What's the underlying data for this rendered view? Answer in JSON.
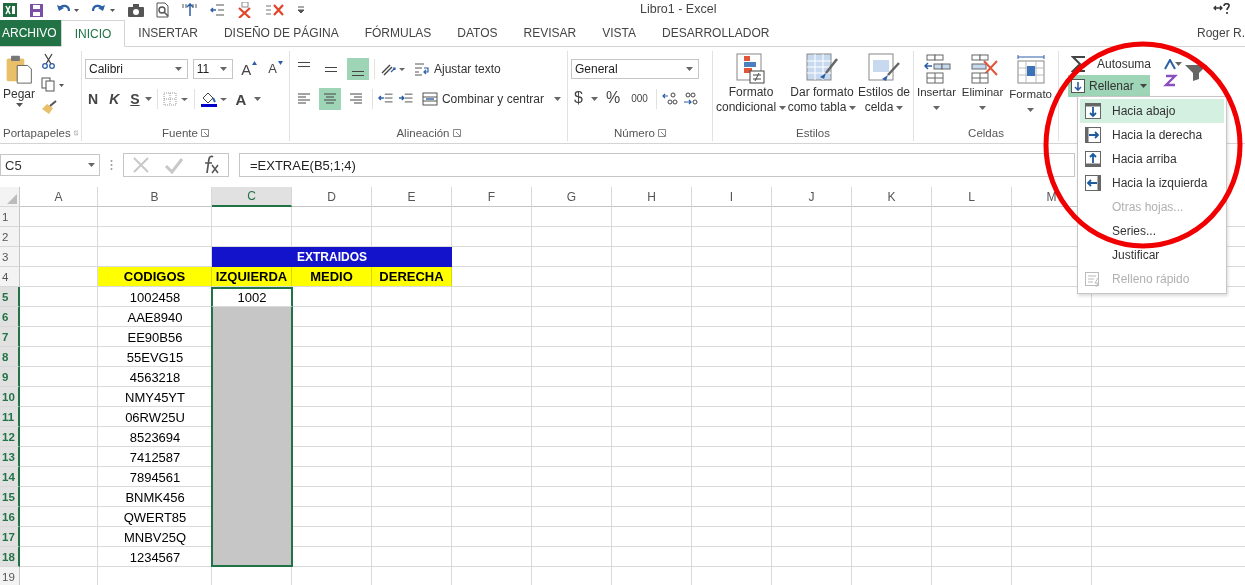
{
  "window": {
    "title": "Libro1 - Excel",
    "user": "Roger R."
  },
  "tabs": [
    {
      "label": "ARCHIVO",
      "kind": "file",
      "selected": false
    },
    {
      "label": "INICIO",
      "kind": "tab",
      "selected": true
    },
    {
      "label": "INSERTAR",
      "kind": "tab",
      "selected": false
    },
    {
      "label": "DISEÑO DE PÁGINA",
      "kind": "tab",
      "selected": false
    },
    {
      "label": "FÓRMULAS",
      "kind": "tab",
      "selected": false
    },
    {
      "label": "DATOS",
      "kind": "tab",
      "selected": false
    },
    {
      "label": "REVISAR",
      "kind": "tab",
      "selected": false
    },
    {
      "label": "VISTA",
      "kind": "tab",
      "selected": false
    },
    {
      "label": "DESARROLLADOR",
      "kind": "tab",
      "selected": false
    }
  ],
  "ribbon": {
    "clipboard": {
      "paste": "Pegar",
      "label": "Portapapeles"
    },
    "font": {
      "name": "Calibri",
      "size": "11",
      "grow": "A",
      "shrink": "A",
      "bold": "N",
      "italic": "K",
      "underline": "S",
      "font_color_label": "A",
      "label": "Fuente"
    },
    "alignment": {
      "vertical": [
        {
          "selected": false
        },
        {
          "selected": false
        },
        {
          "selected": true
        }
      ],
      "horizontal": [
        {
          "selected": false
        },
        {
          "selected": true
        },
        {
          "selected": false
        }
      ],
      "wrap": "Ajustar texto",
      "merge": "Combinar y centrar",
      "label": "Alineación"
    },
    "number": {
      "format": "General",
      "currency": "$",
      "percent": "%",
      "thousands": "000",
      "label": "Número"
    },
    "styles": {
      "buttons": [
        {
          "lines": [
            "Formato",
            "condicional"
          ]
        },
        {
          "lines": [
            "Dar formato",
            "como tabla"
          ]
        },
        {
          "lines": [
            "Estilos de",
            "celda"
          ]
        }
      ],
      "label": "Estilos"
    },
    "cells": {
      "buttons": [
        "Insertar",
        "Eliminar",
        "Formato"
      ],
      "label": "Celdas"
    },
    "editing": {
      "autosum": "Autosuma",
      "fill": {
        "label": "Rellenar",
        "selected": true
      }
    }
  },
  "fill_menu": [
    {
      "label": "Hacia abajo",
      "kind": "down",
      "selected": true,
      "disabled": false
    },
    {
      "label": "Hacia la derecha",
      "kind": "right",
      "selected": false,
      "disabled": false
    },
    {
      "label": "Hacia arriba",
      "kind": "up",
      "selected": false,
      "disabled": false
    },
    {
      "label": "Hacia la izquierda",
      "kind": "left",
      "selected": false,
      "disabled": false
    },
    {
      "label": "Otras hojas...",
      "kind": "plain",
      "selected": false,
      "disabled": true
    },
    {
      "label": "Series...",
      "kind": "plain",
      "selected": false,
      "disabled": false
    },
    {
      "label": "Justificar",
      "kind": "plain",
      "selected": false,
      "disabled": false
    },
    {
      "label": "Relleno rápido",
      "kind": "flash",
      "selected": false,
      "disabled": true
    }
  ],
  "formula_bar": {
    "name_box": "C5",
    "formula": "=EXTRAE(B5;1;4)"
  },
  "sheet": {
    "columns": [
      {
        "label": "A",
        "selected": false
      },
      {
        "label": "B",
        "selected": false
      },
      {
        "label": "C",
        "selected": true
      },
      {
        "label": "D",
        "selected": false
      },
      {
        "label": "E",
        "selected": false
      },
      {
        "label": "F",
        "selected": false
      },
      {
        "label": "G",
        "selected": false
      },
      {
        "label": "H",
        "selected": false
      },
      {
        "label": "I",
        "selected": false
      },
      {
        "label": "J",
        "selected": false
      },
      {
        "label": "K",
        "selected": false
      },
      {
        "label": "L",
        "selected": false
      },
      {
        "label": "M",
        "selected": false
      }
    ],
    "rows": [
      {
        "number": "1",
        "selected": false
      },
      {
        "number": "2",
        "selected": false
      },
      {
        "number": "3",
        "selected": false,
        "merged_title": "EXTRAIDOS"
      },
      {
        "number": "4",
        "selected": false,
        "headers": [
          "CODIGOS",
          "IZQUIERDA",
          "MEDIO",
          "DERECHA"
        ]
      },
      {
        "number": "5",
        "selected": true,
        "active": true,
        "codigo": "1002458",
        "izquierda": "1002"
      },
      {
        "number": "6",
        "selected": true,
        "active": false,
        "codigo": "AAE8940"
      },
      {
        "number": "7",
        "selected": true,
        "active": false,
        "codigo": "EE90B56"
      },
      {
        "number": "8",
        "selected": true,
        "active": false,
        "codigo": "55EVG15"
      },
      {
        "number": "9",
        "selected": true,
        "active": false,
        "codigo": "4563218"
      },
      {
        "number": "10",
        "selected": true,
        "active": false,
        "codigo": "NMY45YT"
      },
      {
        "number": "11",
        "selected": true,
        "active": false,
        "codigo": "06RW25U"
      },
      {
        "number": "12",
        "selected": true,
        "active": false,
        "codigo": "8523694"
      },
      {
        "number": "13",
        "selected": true,
        "active": false,
        "codigo": "7412587"
      },
      {
        "number": "14",
        "selected": true,
        "active": false,
        "codigo": "7894561"
      },
      {
        "number": "15",
        "selected": true,
        "active": false,
        "codigo": "BNMK456"
      },
      {
        "number": "16",
        "selected": true,
        "active": false,
        "codigo": "QWERT85"
      },
      {
        "number": "17",
        "selected": true,
        "active": false,
        "codigo": "MNBV25Q"
      },
      {
        "number": "18",
        "selected": true,
        "active": false,
        "codigo": "1234567"
      },
      {
        "number": "19",
        "selected": false
      }
    ]
  }
}
